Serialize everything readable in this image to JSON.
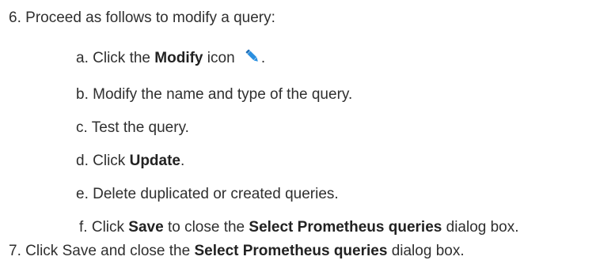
{
  "steps": [
    {
      "marker": "6.",
      "text": "Proceed as follows to modify a query:",
      "substeps": [
        {
          "marker": "a.",
          "parts": [
            "Click the ",
            "Modify",
            " icon",
            "."
          ]
        },
        {
          "marker": "b.",
          "parts": [
            "Modify the name and type of the query."
          ]
        },
        {
          "marker": "c.",
          "parts": [
            "Test the query."
          ]
        },
        {
          "marker": "d.",
          "parts": [
            "Click ",
            "Update",
            "."
          ]
        },
        {
          "marker": "e.",
          "parts": [
            "Delete duplicated or created queries."
          ]
        },
        {
          "marker": "f.",
          "parts": [
            "Click ",
            "Save",
            " to close the ",
            "Select Prometheus queries",
            " dialog box."
          ]
        }
      ]
    },
    {
      "marker": "7.",
      "parts": [
        "Click Save and close the ",
        "Select Prometheus queries",
        " dialog box."
      ]
    }
  ],
  "icons": {
    "modify": "pencil-icon",
    "modify_color": "#2a8fe0"
  }
}
